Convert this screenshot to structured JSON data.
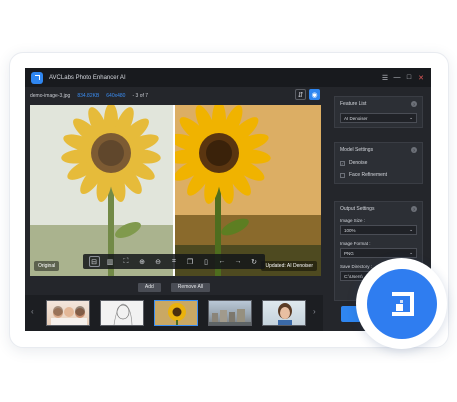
{
  "app": {
    "title": "AVCLabs Photo Enhancer AI",
    "logo_icon": "app-logo-icon",
    "window_controls": [
      "☰",
      "—",
      "□",
      "✕"
    ]
  },
  "info_bar": {
    "filename": "demo-image-3.jpg",
    "filesize": "834.82KB",
    "resolution": "640x480",
    "counter": "- 3 of 7"
  },
  "preview": {
    "left_label": "Original",
    "right_label": "Updated: AI Denoiser"
  },
  "toolbar_icons": [
    "compare-icon",
    "split-icon",
    "fit-icon",
    "zoom-in-icon",
    "zoom-out-icon",
    "crop-icon",
    "copy-icon",
    "delete-icon",
    "back-icon",
    "forward-icon",
    "refresh-icon"
  ],
  "file_actions": {
    "add_label": "Add",
    "remove_all_label": "Remove All"
  },
  "thumbnails": [
    "group-photo",
    "sketch-girl",
    "sunflower",
    "city",
    "woman-portrait"
  ],
  "right_panel": {
    "feature_list": {
      "title": "Feature List",
      "selected": "AI Denoiser"
    },
    "model_settings": {
      "title": "Model Settings",
      "options": [
        {
          "label": "Denoise",
          "checked": true
        },
        {
          "label": "Face Refinement",
          "checked": false
        }
      ]
    },
    "output_settings": {
      "title": "Output Settings",
      "image_size_label": "Image Size :",
      "image_size_value": "100%",
      "image_format_label": "Image Format :",
      "image_format_value": "PNG",
      "save_dir_label": "Save Directory :",
      "save_dir_value": "C:\\Users\\"
    }
  },
  "colors": {
    "accent": "#2f86f0",
    "app_bg": "#24262b",
    "title_bg": "#181a1e"
  }
}
